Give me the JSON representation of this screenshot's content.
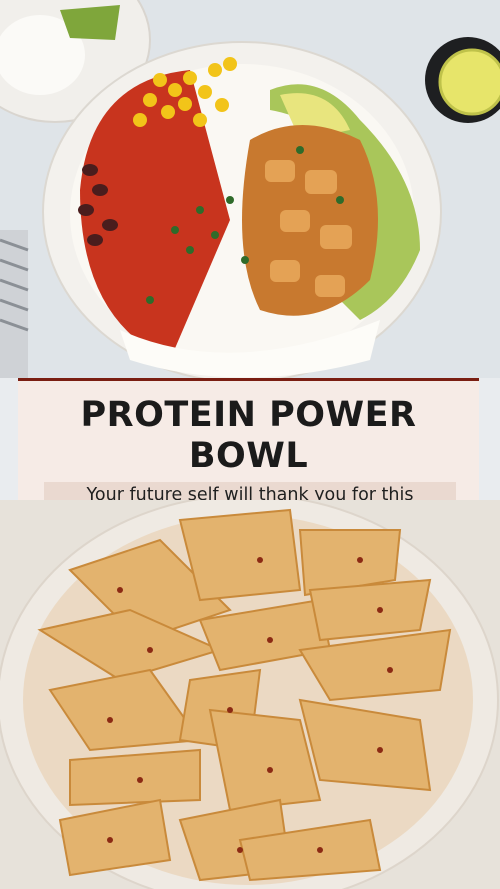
{
  "banner": {
    "title_line1": "PROTEIN POWER",
    "title_line2": "BOWL",
    "subtitle": "Your future self will thank you for this"
  },
  "colors": {
    "banner_bg": "#f6ebe6",
    "banner_rule": "#7a1e12",
    "subtitle_highlight": "#ead9d0",
    "title_text": "#1b1b1b"
  },
  "images": {
    "top_photo": "burrito-bowl-photo",
    "bottom_photo": "sliced-chicken-plate-photo"
  }
}
